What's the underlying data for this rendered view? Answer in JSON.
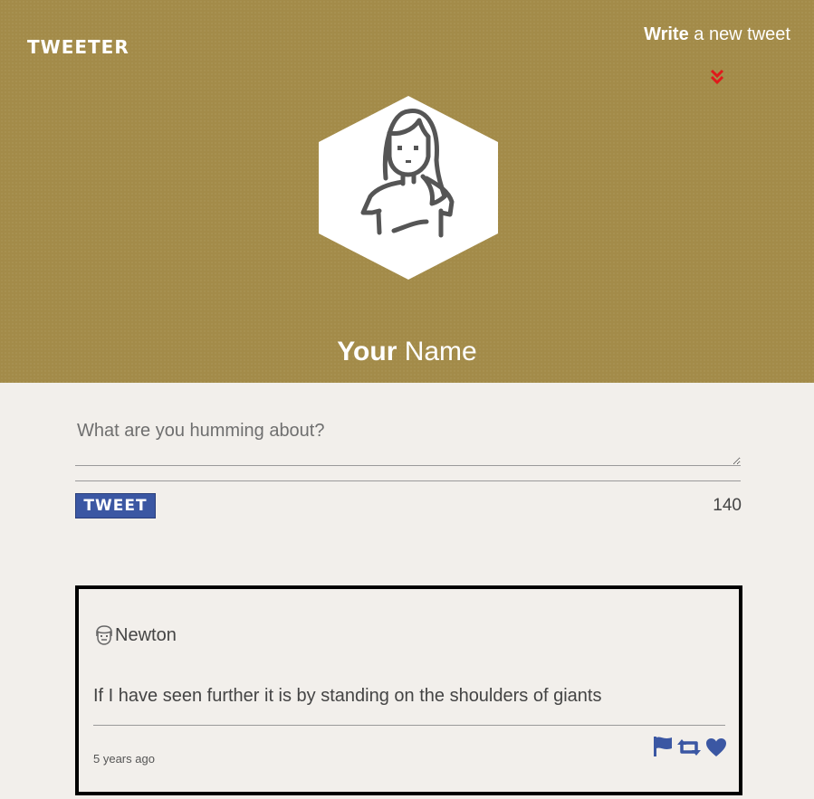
{
  "header": {
    "brand": "TWEETER",
    "compose_toggle_bold": "Write",
    "compose_toggle_rest": " a new tweet",
    "chevron_icon": "double-chevron-down-icon",
    "chevron_color": "#e0191b",
    "background_color": "#a38b49"
  },
  "profile": {
    "avatar_icon": "woman-avatar-icon",
    "name_bold": "Your",
    "name_rest": " Name"
  },
  "compose": {
    "placeholder": "What are you humming about?",
    "button_label": "TWEET",
    "button_color": "#3b57a3",
    "counter": "140"
  },
  "tweets": [
    {
      "avatar_icon": "man-avatar-icon",
      "handle": "Newton",
      "text": "If I have seen further it is by standing on the shoulders of giants",
      "time": "5 years ago",
      "actions": [
        "flag-icon",
        "retweet-icon",
        "heart-icon"
      ],
      "action_color": "#3b57a3"
    }
  ]
}
